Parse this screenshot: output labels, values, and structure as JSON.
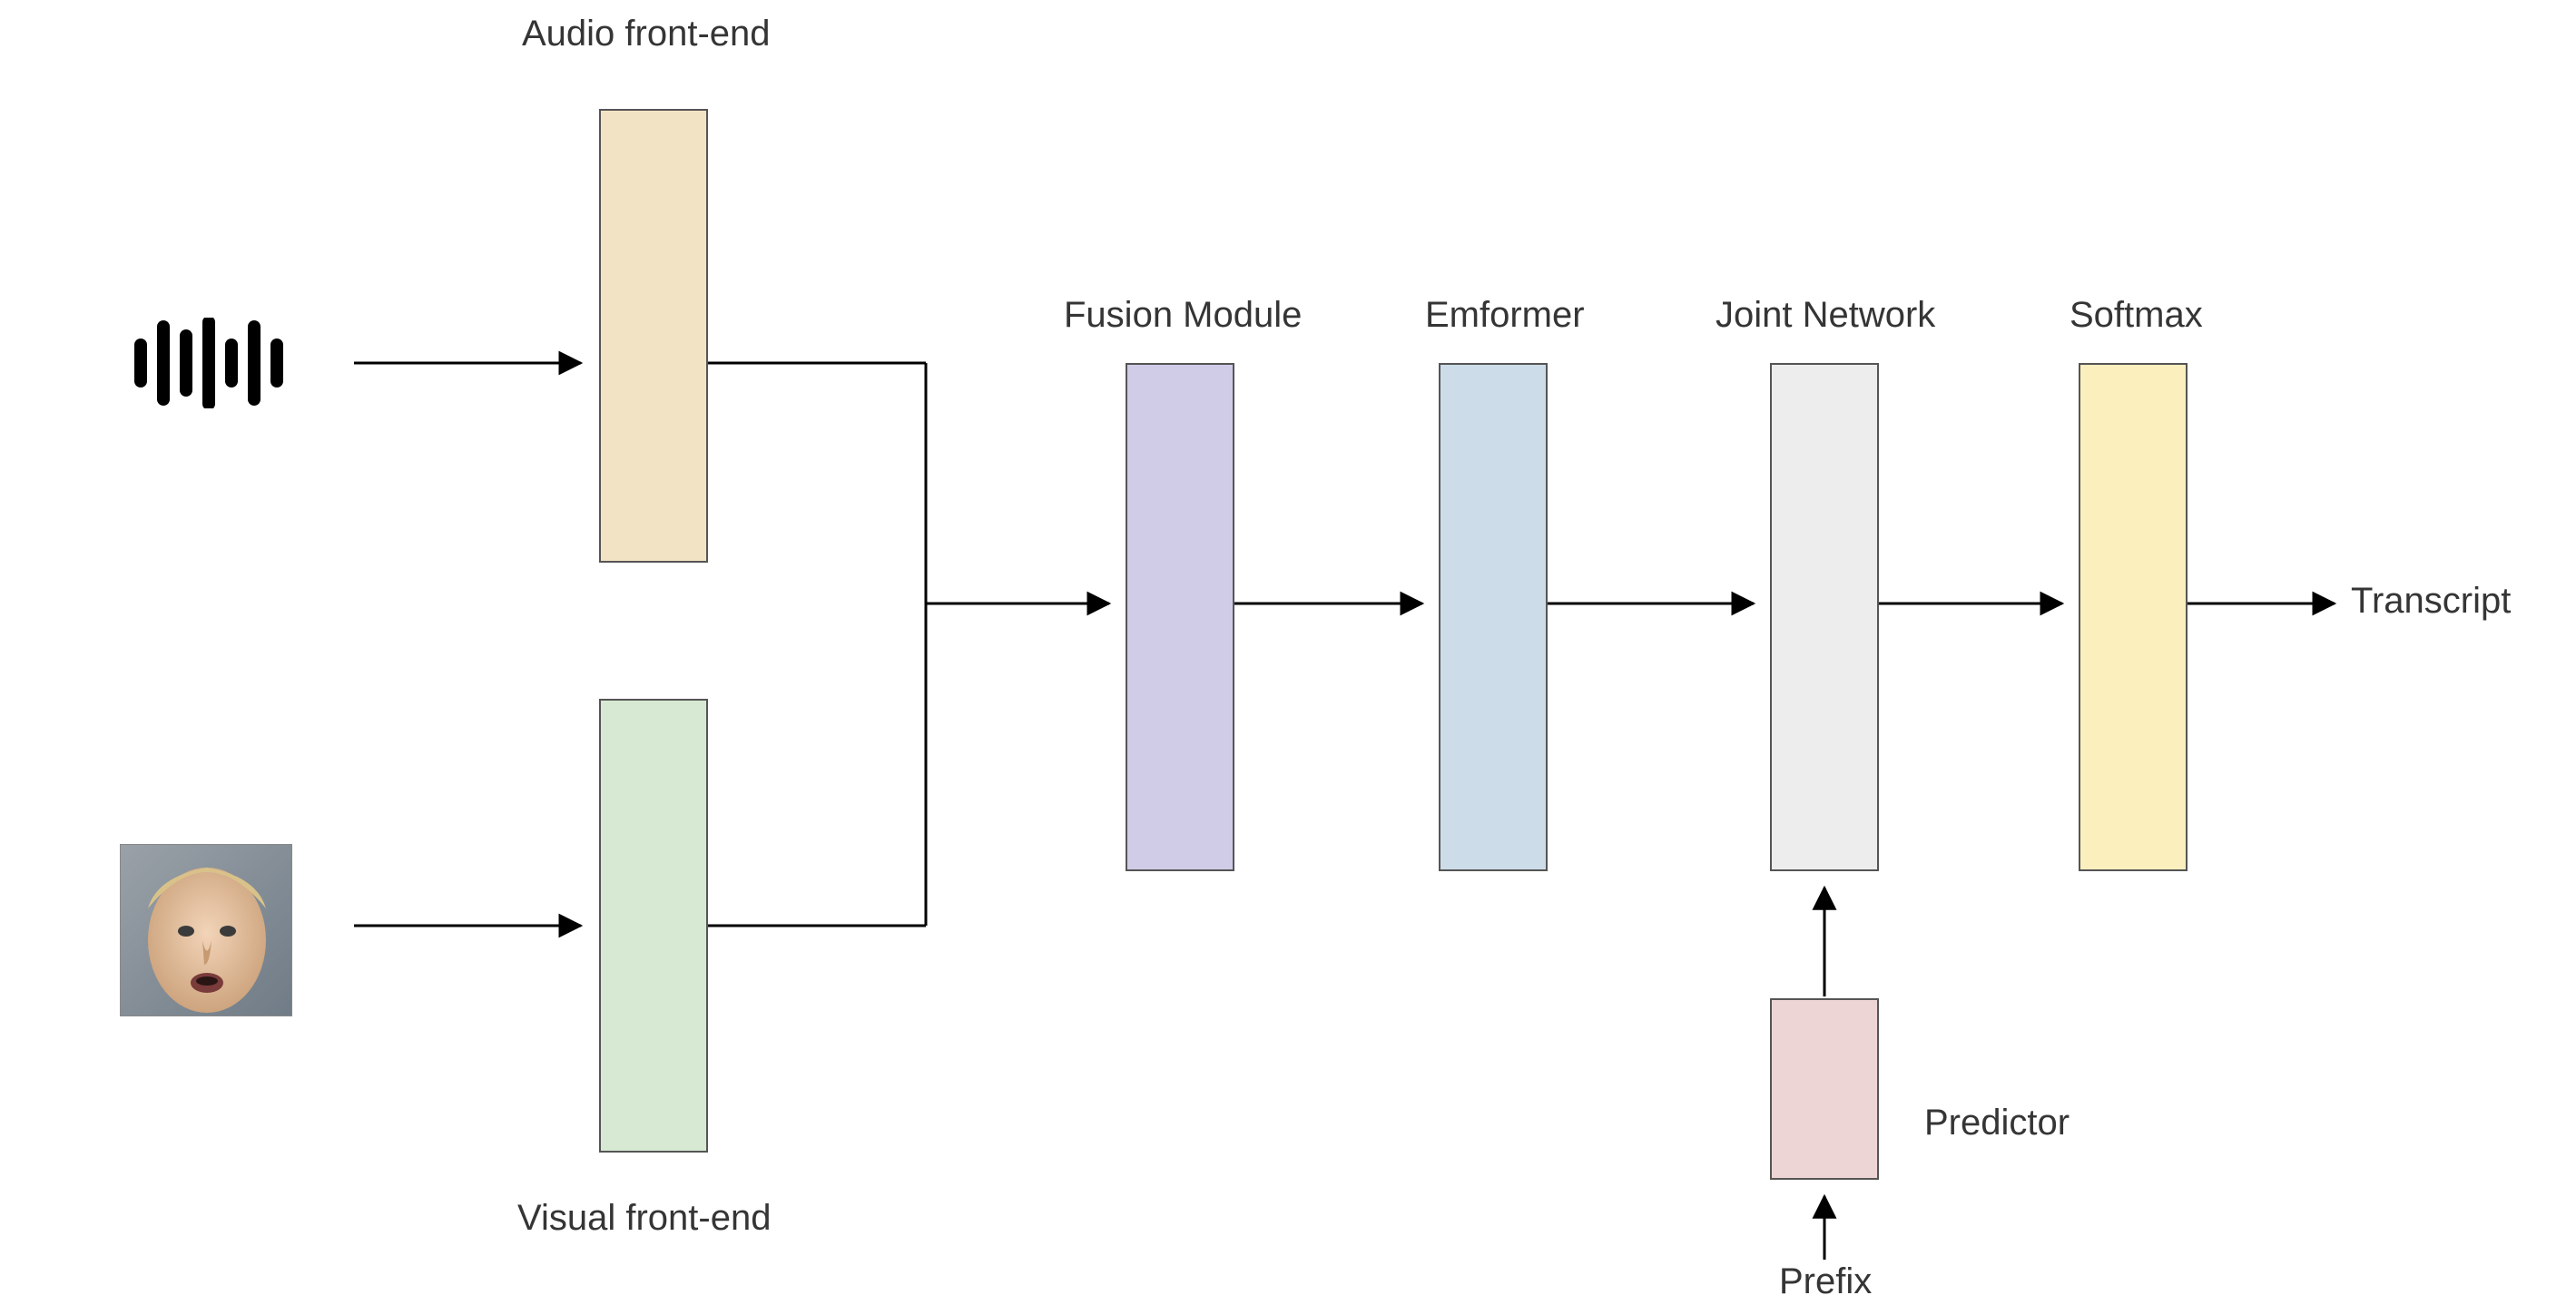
{
  "labels": {
    "audio_frontend": "Audio front-end",
    "visual_frontend": "Visual front-end",
    "fusion_module": "Fusion Module",
    "emformer": "Emformer",
    "joint_network": "Joint Network",
    "softmax": "Softmax",
    "transcript": "Transcript",
    "predictor": "Predictor",
    "prefix": "Prefix"
  },
  "colors": {
    "audio_block": "#F3E3C5",
    "visual_block": "#D7E9D2",
    "fusion_block": "#D0CCE7",
    "emformer_block": "#CDDCE9",
    "joint_block": "#EDEDED",
    "softmax_block": "#FBEFBE",
    "predictor_block": "#EED5D5"
  },
  "diagram": {
    "nodes": [
      {
        "id": "audio_input",
        "type": "icon-waveform"
      },
      {
        "id": "visual_input",
        "type": "image-face"
      },
      {
        "id": "audio_frontend",
        "type": "block"
      },
      {
        "id": "visual_frontend",
        "type": "block"
      },
      {
        "id": "fusion_module",
        "type": "block"
      },
      {
        "id": "emformer",
        "type": "block"
      },
      {
        "id": "joint_network",
        "type": "block"
      },
      {
        "id": "softmax",
        "type": "block"
      },
      {
        "id": "predictor",
        "type": "block"
      },
      {
        "id": "prefix",
        "type": "label-input"
      },
      {
        "id": "transcript",
        "type": "label-output"
      }
    ],
    "edges": [
      {
        "from": "audio_input",
        "to": "audio_frontend"
      },
      {
        "from": "visual_input",
        "to": "visual_frontend"
      },
      {
        "from": "audio_frontend",
        "to": "fusion_module"
      },
      {
        "from": "visual_frontend",
        "to": "fusion_module"
      },
      {
        "from": "fusion_module",
        "to": "emformer"
      },
      {
        "from": "emformer",
        "to": "joint_network"
      },
      {
        "from": "joint_network",
        "to": "softmax"
      },
      {
        "from": "softmax",
        "to": "transcript"
      },
      {
        "from": "prefix",
        "to": "predictor"
      },
      {
        "from": "predictor",
        "to": "joint_network"
      }
    ]
  }
}
